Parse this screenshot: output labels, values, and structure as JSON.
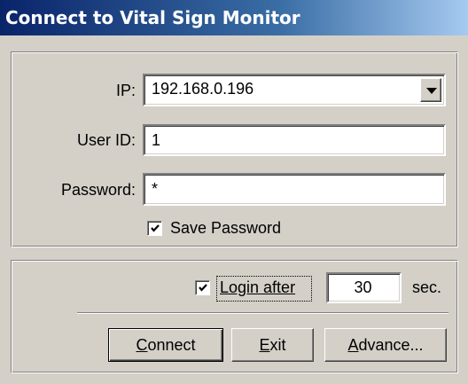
{
  "window": {
    "title": "Connect to Vital Sign Monitor"
  },
  "connection": {
    "ip_label": "IP:",
    "ip_value": "192.168.0.196",
    "userid_label": "User ID:",
    "userid_value": "1",
    "password_label": "Password:",
    "password_value": "*",
    "save_password_label": "Save Password",
    "save_password_checked": true
  },
  "login": {
    "login_after_label": "Login after",
    "login_after_checked": true,
    "seconds_value": "30",
    "seconds_unit": "sec."
  },
  "buttons": {
    "connect_first": "C",
    "connect_rest": "onnect",
    "exit_first": "E",
    "exit_rest": "xit",
    "advance_first": "A",
    "advance_rest": "dvance..."
  }
}
